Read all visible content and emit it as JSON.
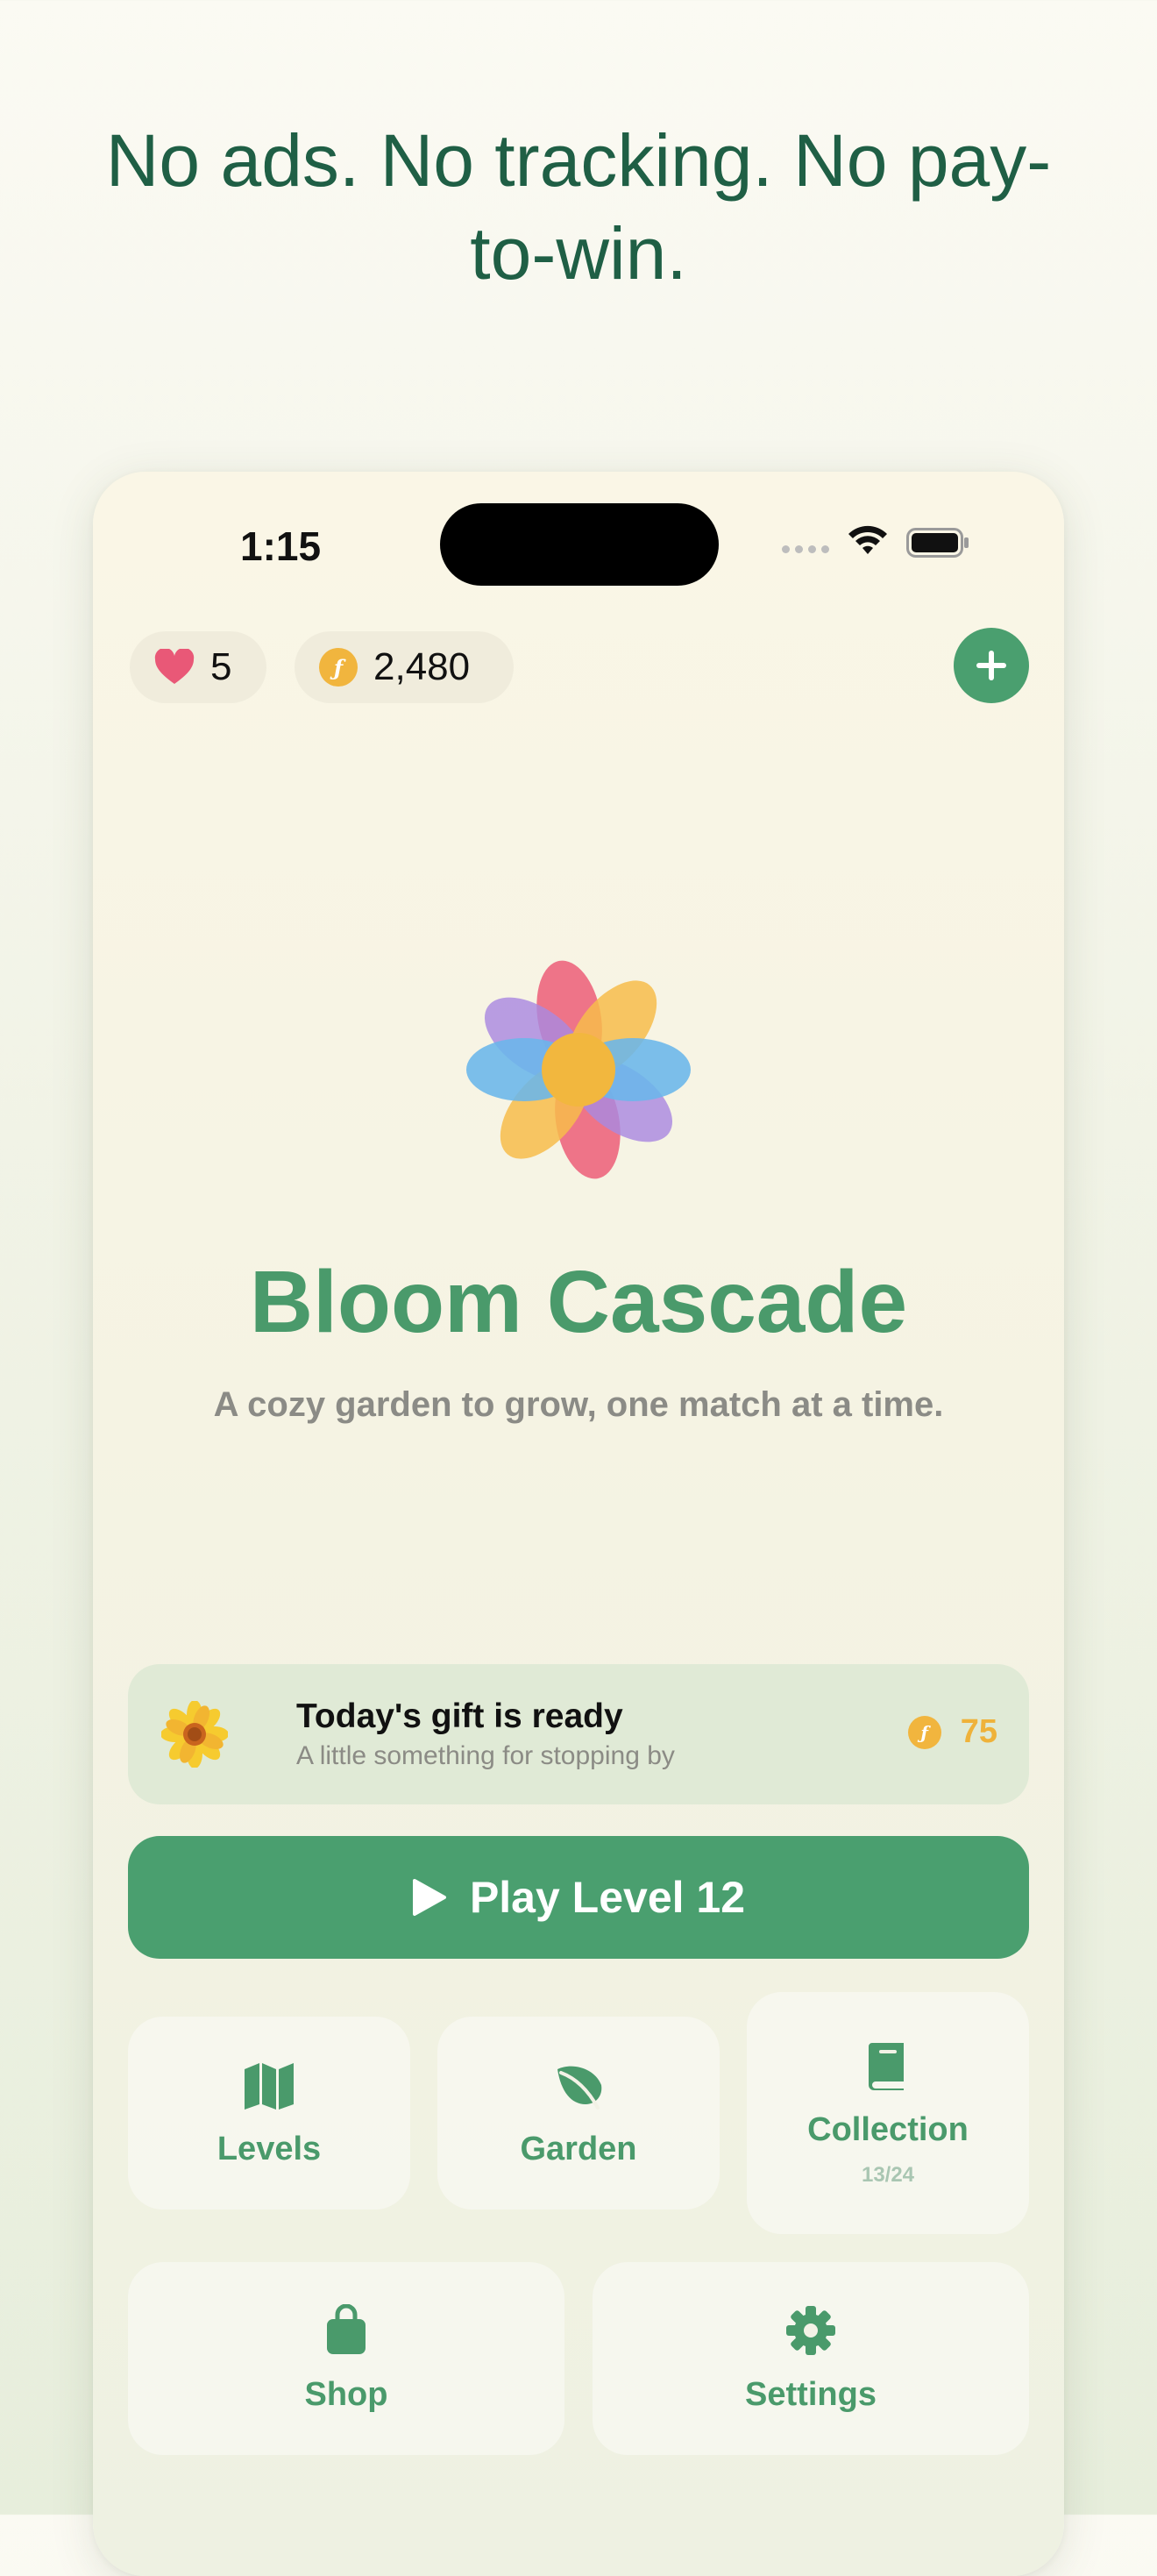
{
  "headline": "No ads. No tracking. No pay-to-win.",
  "status_bar": {
    "time": "1:15"
  },
  "currency": {
    "lives": "5",
    "coins": "2,480",
    "coin_symbol": "ƒ"
  },
  "hero": {
    "title": "Bloom Cascade",
    "subtitle": "A cozy garden to grow, one match at a time."
  },
  "gift": {
    "title": "Today's gift is ready",
    "subtitle": "A little something for stopping by",
    "amount": "75"
  },
  "play_button": {
    "label": "Play Level 12"
  },
  "menu": {
    "levels": "Levels",
    "garden": "Garden",
    "collection": "Collection",
    "collection_count": "13/24",
    "shop": "Shop",
    "settings": "Settings"
  },
  "colors": {
    "primary_green": "#4a9f6f",
    "title_green": "#4a9a6b",
    "headline_green": "#1f5f45",
    "coin_gold": "#f1b53e",
    "heart_pink": "#e95877"
  },
  "icons": [
    "heart-icon",
    "coin-icon",
    "plus-icon",
    "flower-logo",
    "sunflower-icon",
    "play-icon",
    "map-icon",
    "leaf-icon",
    "book-icon",
    "bag-icon",
    "gear-icon"
  ]
}
